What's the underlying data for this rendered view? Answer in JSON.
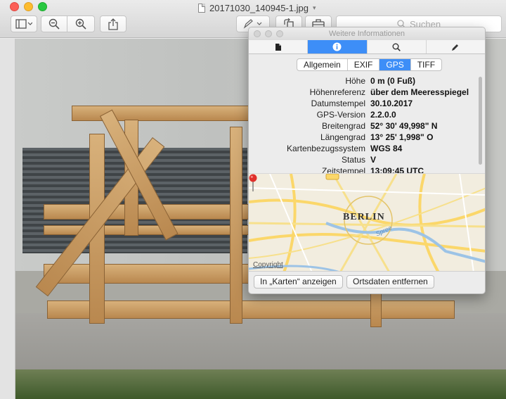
{
  "window": {
    "title": "20171030_140945-1.jpg"
  },
  "toolbar": {
    "sidebar_icon": "sidebar-icon",
    "zoom_out_icon": "zoom-out-icon",
    "zoom_in_icon": "zoom-in-icon",
    "share_icon": "share-icon",
    "markup_icon": "pen-icon",
    "rotate_icon": "rotate-icon",
    "toolbox_icon": "toolbox-icon",
    "search_placeholder": "Suchen"
  },
  "inspector": {
    "title": "Weitere Informationen",
    "tabs": [
      {
        "icon": "document-icon",
        "selected": false
      },
      {
        "icon": "info-icon",
        "selected": true
      },
      {
        "icon": "magnifier-icon",
        "selected": false
      },
      {
        "icon": "pencil-icon",
        "selected": false
      }
    ],
    "segments": [
      {
        "label": "Allgemein",
        "selected": false
      },
      {
        "label": "EXIF",
        "selected": false
      },
      {
        "label": "GPS",
        "selected": true
      },
      {
        "label": "TIFF",
        "selected": false
      }
    ],
    "properties": [
      {
        "key": "Höhe",
        "value": "0 m (0 Fuß)"
      },
      {
        "key": "Höhenreferenz",
        "value": "über dem Meeresspiegel"
      },
      {
        "key": "Datumstempel",
        "value": "30.10.2017"
      },
      {
        "key": "GPS-Version",
        "value": "2.2.0.0"
      },
      {
        "key": "Breitengrad",
        "value": "52° 30' 49,998\" N"
      },
      {
        "key": "Längengrad",
        "value": "13° 25' 1,998\" O"
      },
      {
        "key": "Kartenbezugssystem",
        "value": "WGS 84"
      },
      {
        "key": "Status",
        "value": "V"
      },
      {
        "key": "Zeitstempel",
        "value": "13:09:45 UTC"
      }
    ],
    "map": {
      "city_label": "BERLIN",
      "river_label": "Spree",
      "copyright": "Copyright"
    },
    "buttons": {
      "show_in_maps": "In „Karten“ anzeigen",
      "remove_location": "Ortsdaten entfernen"
    }
  },
  "colors": {
    "accent": "#3d8ef7",
    "pin": "#e0302b"
  }
}
